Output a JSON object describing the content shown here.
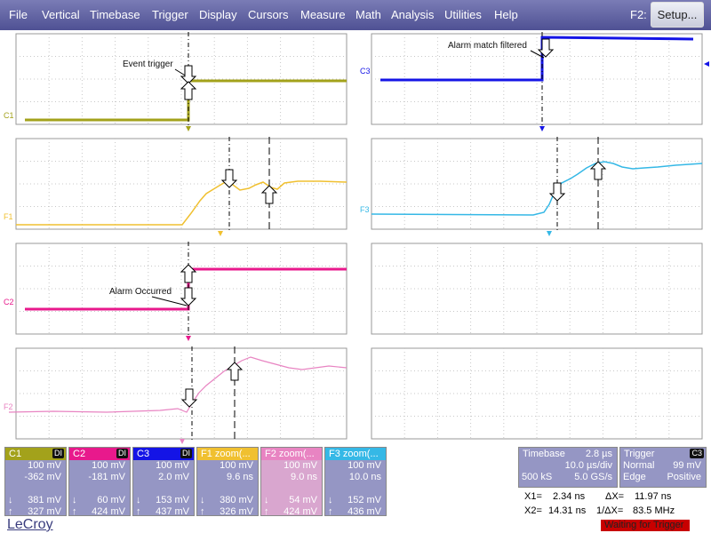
{
  "menu": {
    "items": [
      "File",
      "Vertical",
      "Timebase",
      "Trigger",
      "Display",
      "Cursors",
      "Measure",
      "Math",
      "Analysis",
      "Utilities",
      "Help"
    ],
    "f2_label": "F2:",
    "setup_button": "Setup..."
  },
  "grids": {
    "annotations": {
      "event_trigger": "Event trigger",
      "alarm_match": "Alarm match filtered",
      "alarm_occurred": "Alarm Occurred"
    },
    "trace_labels": {
      "c1": "C1",
      "c3": "C3",
      "f1": "F1",
      "f3": "F3",
      "c2": "C2",
      "f2": "F2"
    }
  },
  "colors": {
    "c1": "#a3a21b",
    "c2": "#e8198c",
    "c3": "#1414e6",
    "f1": "#f0c030",
    "f2": "#e884c2",
    "f3": "#35b8e6",
    "menu": "#5b5d9e",
    "panel": "#9596c4"
  },
  "channels": [
    {
      "name": "C1",
      "badge": "DI",
      "color": "#a3a21b",
      "scale": "100 mV",
      "offset": "-362 mV",
      "line3": "",
      "val1": "381 mV",
      "val2": "327 mV"
    },
    {
      "name": "C2",
      "badge": "DI",
      "color": "#e8198c",
      "scale": "100 mV",
      "offset": "-181 mV",
      "line3": "",
      "val1": "60 mV",
      "val2": "424 mV"
    },
    {
      "name": "C3",
      "badge": "DI",
      "color": "#1414e6",
      "scale": "100 mV",
      "offset": "2.0 mV",
      "line3": "",
      "val1": "153 mV",
      "val2": "437 mV"
    },
    {
      "name": "F1 zoom(...",
      "badge": "",
      "color": "#f0c030",
      "scale": "100 mV",
      "offset": "",
      "line3": "9.6 ns",
      "val1": "380 mV",
      "val2": "326 mV"
    },
    {
      "name": "F2 zoom(...",
      "badge": "",
      "color": "#e884c2",
      "scale": "100 mV",
      "offset": "",
      "line3": "9.0 ns",
      "val1": "54 mV",
      "val2": "424 mV"
    },
    {
      "name": "F3 zoom(...",
      "badge": "",
      "color": "#35b8e6",
      "scale": "100 mV",
      "offset": "",
      "line3": "10.0 ns",
      "val1": "152 mV",
      "val2": "436 mV"
    }
  ],
  "timebase": {
    "title": "Timebase",
    "delay": "2.8 µs",
    "per_div": "10.0 µs/div",
    "samples": "500 kS",
    "rate": "5.0 GS/s"
  },
  "trigger": {
    "title": "Trigger",
    "badge": "C3",
    "mode": "Normal",
    "level": "99 mV",
    "type": "Edge",
    "slope": "Positive"
  },
  "cursors": {
    "x1_label": "X1=",
    "x1": "2.34 ns",
    "x2_label": "X2=",
    "x2": "14.31 ns",
    "dx_label": "ΔX=",
    "dx": "11.97 ns",
    "inv_label": "1/ΔX=",
    "inv": "83.5 MHz"
  },
  "status": "Waiting for Trigger",
  "brand": "LeCroy"
}
